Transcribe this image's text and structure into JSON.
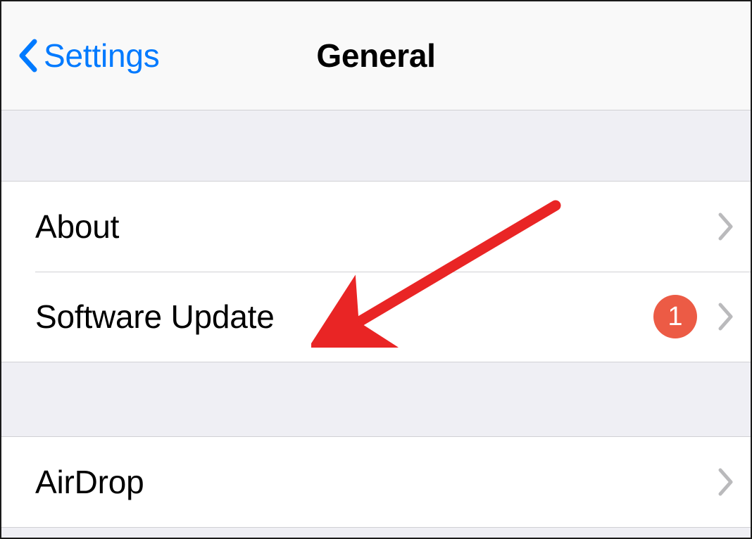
{
  "nav": {
    "back_label": "Settings",
    "title": "General"
  },
  "sections": {
    "first": {
      "items": [
        {
          "label": "About"
        },
        {
          "label": "Software Update",
          "badge": "1"
        }
      ]
    },
    "second": {
      "items": [
        {
          "label": "AirDrop"
        }
      ]
    }
  },
  "colors": {
    "accent": "#007aff",
    "badge": "#ec5b45",
    "background_group": "#efeff4",
    "annotation": "#e92525"
  }
}
